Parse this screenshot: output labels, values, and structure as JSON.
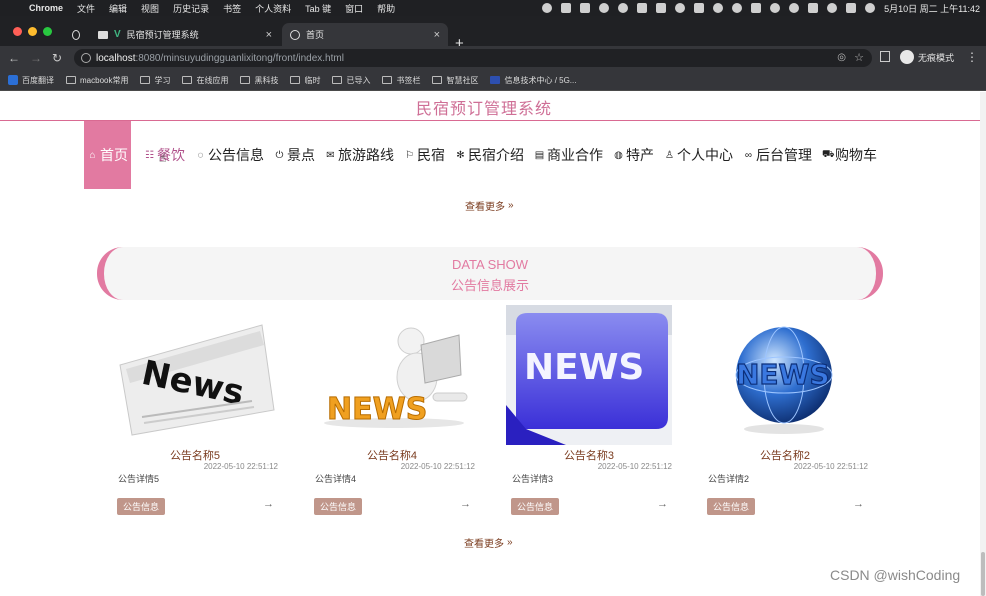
{
  "menubar": {
    "app": "Chrome",
    "items": [
      "文件",
      "编辑",
      "视图",
      "历史记录",
      "书签",
      "个人资料",
      "Tab 键",
      "窗口",
      "帮助"
    ],
    "datetime": "5月10日 周二 上午11:42"
  },
  "tabs": [
    {
      "title": "",
      "active": false
    },
    {
      "title": "民宿预订管理系统",
      "active": false
    },
    {
      "title": "首页",
      "active": true
    }
  ],
  "address": {
    "host": "localhost",
    "path": ":8080/minsuyudingguanlixitong/front/index.html",
    "profile": "无痕模式"
  },
  "bookmarks": [
    "百度翻译",
    "macbook常用",
    "学习",
    "在线应用",
    "黑科技",
    "临时",
    "已导入",
    "书签栏",
    "智慧社区",
    "信息技术中心 / 5G..."
  ],
  "site": {
    "title": "民宿预订管理系统",
    "nav": [
      {
        "label": "首页",
        "icon": "home-icon",
        "glyph": "⌂"
      },
      {
        "label": "餐饮",
        "icon": "dining-icon",
        "glyph": "☷"
      },
      {
        "label": "公告信息",
        "icon": "chat-icon",
        "glyph": "◌"
      },
      {
        "label": "景点",
        "icon": "power-icon",
        "glyph": "⏻"
      },
      {
        "label": "旅游路线",
        "icon": "mail-icon",
        "glyph": "✉"
      },
      {
        "label": "民宿",
        "icon": "flag-icon",
        "glyph": "⚐"
      },
      {
        "label": "民宿介绍",
        "icon": "snow-icon",
        "glyph": "✻"
      },
      {
        "label": "商业合作",
        "icon": "calendar-icon",
        "glyph": "▤"
      },
      {
        "label": "特产",
        "icon": "globe-icon",
        "glyph": "◍"
      },
      {
        "label": "个人中心",
        "icon": "user-icon",
        "glyph": "♙"
      },
      {
        "label": "后台管理",
        "icon": "link-icon",
        "glyph": "∞"
      },
      {
        "label": "购物车",
        "icon": "cart-icon",
        "glyph": "⛟"
      }
    ],
    "more_top": "查看更多",
    "section": {
      "en": "DATA SHOW",
      "cn": "公告信息展示"
    },
    "cards": [
      {
        "name": "公告名称5",
        "time": "2022-05-10 22:51:12",
        "detail": "公告详情5",
        "tag": "公告信息",
        "img_text": "News"
      },
      {
        "name": "公告名称4",
        "time": "2022-05-10 22:51:12",
        "detail": "公告详情4",
        "tag": "公告信息",
        "img_text": "NEWS"
      },
      {
        "name": "公告名称3",
        "time": "2022-05-10 22:51:12",
        "detail": "公告详情3",
        "tag": "公告信息",
        "img_text": "NEWS"
      },
      {
        "name": "公告名称2",
        "time": "2022-05-10 22:51:12",
        "detail": "公告详情2",
        "tag": "公告信息",
        "img_text": "NEWS"
      }
    ],
    "more_bottom": "查看更多"
  },
  "watermark": "CSDN @wishCoding",
  "colors": {
    "accent": "#e27aa1",
    "brown": "#7a3b1e",
    "tag": "#c0968a"
  }
}
